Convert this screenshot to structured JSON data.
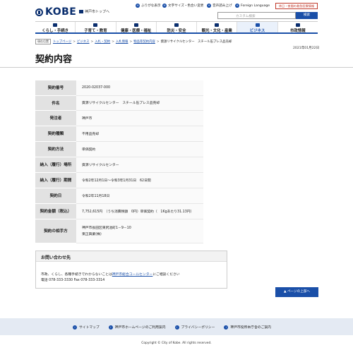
{
  "header": {
    "logo_text": "KOBE",
    "city_top": "神戸市トップへ",
    "util": [
      {
        "label": "ふりがな表示",
        "icon": "text-icon"
      },
      {
        "label": "文字サイズ・色合い変更",
        "icon": "font-size-icon"
      },
      {
        "label": "音声読み上げ",
        "icon": "speaker-icon"
      },
      {
        "label": "Foreign Language",
        "icon": "globe-icon"
      }
    ],
    "emergency": "休日・夜間の救急医療情報",
    "search_placeholder": "カスタム検索",
    "search_button": "検索"
  },
  "gnav": [
    {
      "label": "くらし・手続き",
      "active": false
    },
    {
      "label": "子育て・教育",
      "active": false
    },
    {
      "label": "健康・医療・福祉",
      "active": false
    },
    {
      "label": "防災・安全",
      "active": false
    },
    {
      "label": "観光・文化・産業",
      "active": false
    },
    {
      "label": "ビジネス",
      "active": true
    },
    {
      "label": "市政情報",
      "active": false
    }
  ],
  "breadcrumb": {
    "here": "現在位置",
    "items": [
      "トップページ",
      "ビジネス",
      "入札・契約",
      "入札情報",
      "物品等契約内容"
    ],
    "current": "資源リサイクルセンター　スチール缶プレス品売却"
  },
  "date": "2021年01月22日",
  "page_title": "契約内容",
  "contract": {
    "rows": [
      {
        "label": "契約番号",
        "value": "2020-02037-000"
      },
      {
        "label": "件名",
        "value": "資源リサイクルセンター　スチール缶プレス品売却"
      },
      {
        "label": "発注者",
        "value": "神戸市"
      },
      {
        "label": "契約種類",
        "value": "不用品売却"
      },
      {
        "label": "契約方法",
        "value": "単価契約"
      },
      {
        "label": "納入（履行）場所",
        "value": "資源リサイクルセンター"
      },
      {
        "label": "納入（履行）期間",
        "value": "令和2年12月1日～令和3年1月31日　62日間"
      },
      {
        "label": "契約日",
        "value": "令和2年11月18日"
      },
      {
        "label": "契約金額（税込）",
        "value": "7,752,615円　（うち消費税額　0円）単価契約（　1Kgあたり31.13円）"
      },
      {
        "label": "契約の相手方",
        "value": "神戸市長田区東尻池町1－9－10",
        "value2": "東正興業(株)"
      }
    ]
  },
  "inquiry": {
    "title": "お問い合わせ先",
    "line1_pre": "市政、くらし、各種手続きでわからないことは",
    "line1_link": "神戸市総合コールセンター",
    "line1_post": "にご相談ください",
    "line2": "電話 078-333-3330 Fax 078-333-3314"
  },
  "page_top": "ページの上部へ",
  "footer": {
    "links": [
      "サイトマップ",
      "神戸市ホームページのご利用案内",
      "プライバシーポリシー",
      "神戸市役所本庁舎のご案内"
    ],
    "copyright": "Copyright © City of Kobe. All rights reserved."
  },
  "colors": {
    "accent": "#1a4fa8",
    "brand": "#0a2e6e",
    "emergency": "#c0392b"
  }
}
